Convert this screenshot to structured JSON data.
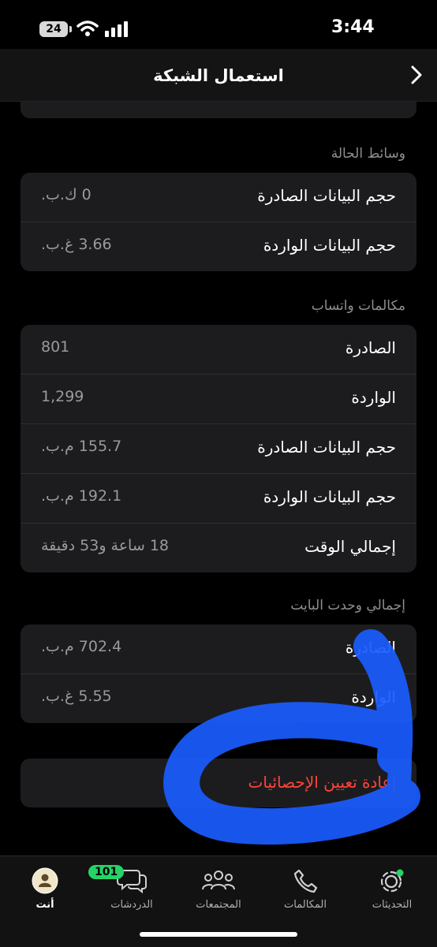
{
  "status": {
    "time": "3:44",
    "battery": "24"
  },
  "nav": {
    "title": "استعمال الشبكة"
  },
  "sections": [
    {
      "header": "وسائط الحالة",
      "rows": [
        {
          "label": "حجم البيانات الصادرة",
          "value": "0 ك.ب."
        },
        {
          "label": "حجم البيانات الواردة",
          "value": "3.66 غ.ب."
        }
      ]
    },
    {
      "header": "مكالمات واتساب",
      "rows": [
        {
          "label": "الصادرة",
          "value": "801"
        },
        {
          "label": "الواردة",
          "value": "1,299"
        },
        {
          "label": "حجم البيانات الصادرة",
          "value": "155.7 م.ب."
        },
        {
          "label": "حجم البيانات الواردة",
          "value": "192.1 م.ب."
        },
        {
          "label": "إجمالي الوقت",
          "value": "18 ساعة و53 دقيقة"
        }
      ]
    },
    {
      "header": "إجمالي وحدت البايت",
      "rows": [
        {
          "label": "الصادرة",
          "value": "702.4 م.ب."
        },
        {
          "label": "الواردة",
          "value": "5.55 غ.ب."
        }
      ]
    }
  ],
  "reset": {
    "label": "إعادة تعيين الإحصائيات"
  },
  "tabs": [
    {
      "label": "التحديثات"
    },
    {
      "label": "المكالمات"
    },
    {
      "label": "المجتمعات"
    },
    {
      "label": "الدردشات",
      "badge": "101"
    },
    {
      "label": "أنت"
    }
  ],
  "colors": {
    "background": "#000000",
    "card": "#1c1c1e",
    "destructive": "#ff453a",
    "badge": "#25d366",
    "scribble": "#1a5cff"
  }
}
